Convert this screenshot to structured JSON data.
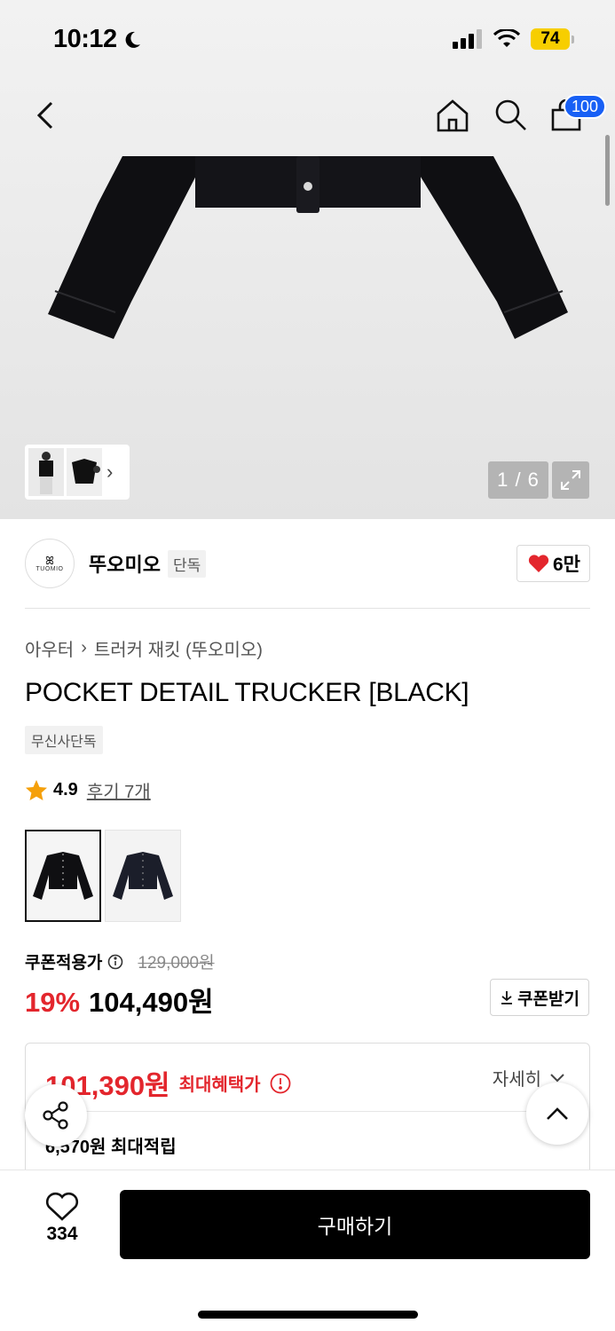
{
  "status_bar": {
    "time": "10:12",
    "battery": "74"
  },
  "header": {
    "cart_count": "100"
  },
  "gallery": {
    "page_counter": "1 / 6"
  },
  "brand": {
    "logo_text": "TUOMIO",
    "name": "뚜오미오",
    "tag": "단독",
    "likes": "6만"
  },
  "breadcrumb": {
    "category": "아우터",
    "subcategory": "트러커 재킷 (뚜오미오)"
  },
  "product": {
    "title": "POCKET DETAIL TRUCKER [BLACK]",
    "exclusive_tag": "무신사단독",
    "rating": "4.9",
    "review_link": "후기 7개"
  },
  "pricing": {
    "coupon_label": "쿠폰적용가",
    "original_price": "129,000원",
    "discount": "19%",
    "sale_price": "104,490원",
    "coupon_button": "쿠폰받기"
  },
  "benefit": {
    "max_price": "101,390원",
    "max_label": "최대혜택가",
    "detail_label": "자세히",
    "points": "6,570원 최대적립"
  },
  "bottom_bar": {
    "wish_count": "334",
    "buy_label": "구매하기"
  },
  "colors": {
    "accent_red": "#e3262d",
    "badge_blue": "#1860f5",
    "battery_yellow": "#f7ce00"
  }
}
